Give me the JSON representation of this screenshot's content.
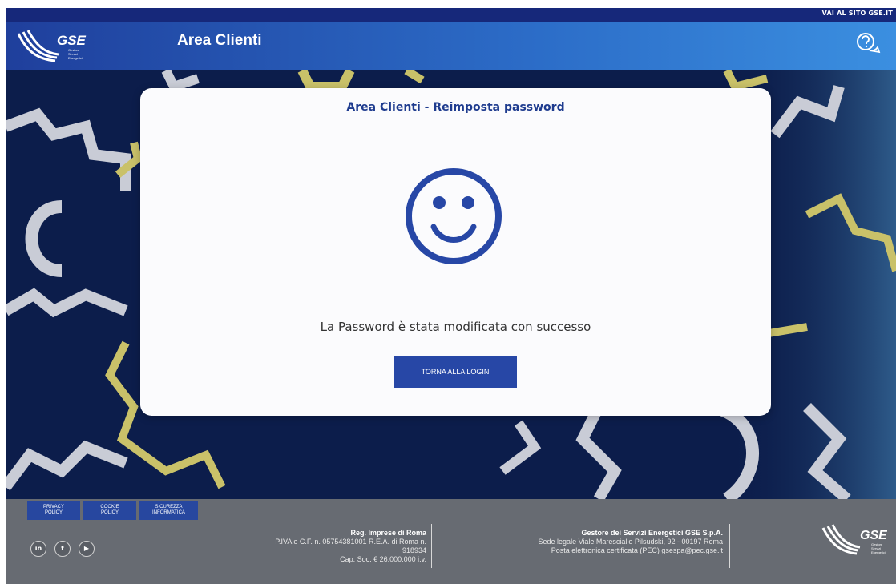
{
  "topbar": {
    "site_link": "VAI AL SITO GSE.IT"
  },
  "header": {
    "brand": "GSE",
    "brand_subtitle": [
      "Gestore",
      "Servizi",
      "Energetici"
    ],
    "title": "Area Clienti",
    "help_icon": "help-chat-icon"
  },
  "card": {
    "title": "Area Clienti - Reimposta password",
    "icon": "smiley-icon",
    "message": "La Password è stata modificata con successo",
    "button_label": "TORNA ALLA LOGIN"
  },
  "footer": {
    "links": [
      {
        "line1": "PRIVACY",
        "line2": "POLICY"
      },
      {
        "line1": "COOKIE",
        "line2": "POLICY"
      },
      {
        "line1": "SICUREZZA",
        "line2": "INFORMATICA"
      }
    ],
    "social": [
      {
        "icon": "linkedin-icon",
        "label": "in"
      },
      {
        "icon": "twitter-icon",
        "label": "t"
      },
      {
        "icon": "youtube-icon",
        "label": "▶"
      }
    ],
    "reg": {
      "title": "Reg. Imprese di Roma",
      "line1": "P.IVA e C.F. n. 05754381001 R.E.A. di Roma n.",
      "line2": "918934",
      "line3": "Cap. Soc. € 26.000.000 i.v."
    },
    "company": {
      "title": "Gestore dei Servizi Energetici GSE S.p.A.",
      "line1": "Sede legale Viale Maresciallo Pilsudski, 92 - 00197 Roma",
      "line2": "Posta elettronica certificata (PEC) gsespa@pec.gse.it"
    },
    "logo_brand": "GSE",
    "logo_subtitle": [
      "Gestore",
      "Servizi",
      "Energetici"
    ]
  },
  "colors": {
    "header_start": "#1f3f9c",
    "header_end": "#3b8fe0",
    "hero_bg": "#0c1d4b",
    "accent": "#2747a6",
    "title_blue": "#1f3c8f",
    "footer_bg": "#676b72",
    "gear_gray": "#c9ccd6",
    "gear_yellow": "#c9c169"
  }
}
